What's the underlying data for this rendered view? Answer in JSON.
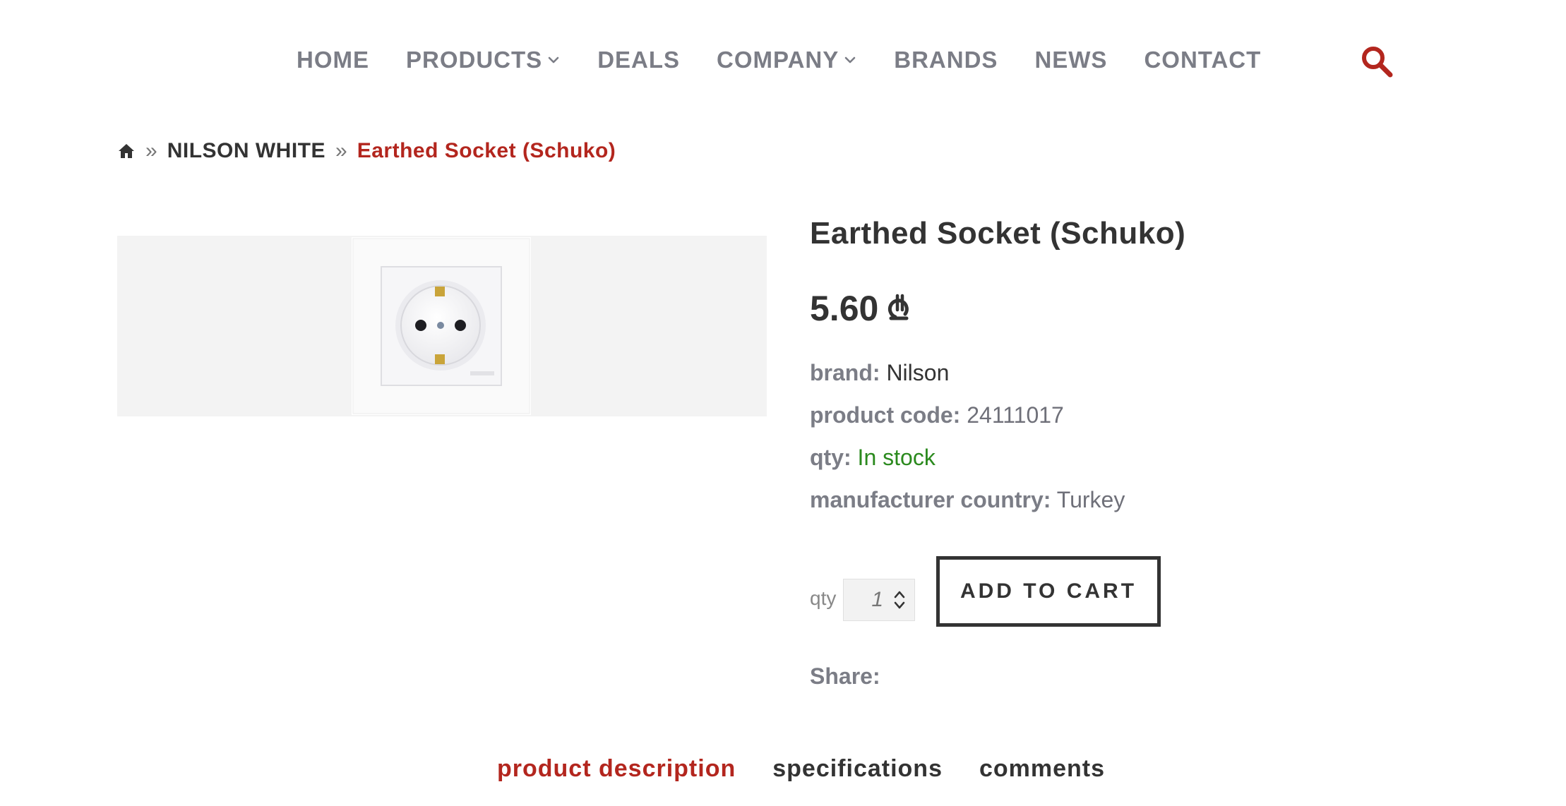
{
  "nav": {
    "items": [
      {
        "label": "HOME",
        "has_dropdown": false
      },
      {
        "label": "PRODUCTS",
        "has_dropdown": true
      },
      {
        "label": "DEALS",
        "has_dropdown": false
      },
      {
        "label": "COMPANY",
        "has_dropdown": true
      },
      {
        "label": "BRANDS",
        "has_dropdown": false
      },
      {
        "label": "NEWS",
        "has_dropdown": false
      },
      {
        "label": "CONTACT",
        "has_dropdown": false
      }
    ],
    "search_icon": "search-icon"
  },
  "breadcrumb": {
    "home_icon": "home-icon",
    "separator": "»",
    "category": "NILSON WHITE",
    "current": "Earthed Socket (Schuko)"
  },
  "product": {
    "title": "Earthed Socket (Schuko)",
    "price": "5.60",
    "currency_icon": "lari-currency-icon",
    "attributes": {
      "brand": {
        "label": "brand:",
        "value": "Nilson"
      },
      "code": {
        "label": "product code:",
        "value": "24111017"
      },
      "qty": {
        "label": "qty:",
        "value": "In stock"
      },
      "country": {
        "label": "manufacturer country:",
        "value": "Turkey"
      }
    },
    "quantity": {
      "label": "qty",
      "value": "1"
    },
    "add_to_cart": "ADD TO CART",
    "share_label": "Share:"
  },
  "tabs": [
    {
      "label": "product description",
      "active": true
    },
    {
      "label": "specifications",
      "active": false
    },
    {
      "label": "comments",
      "active": false
    }
  ],
  "colors": {
    "accent": "#b3261e",
    "nav_text": "#7b7d86",
    "in_stock": "#2b8a1e"
  }
}
